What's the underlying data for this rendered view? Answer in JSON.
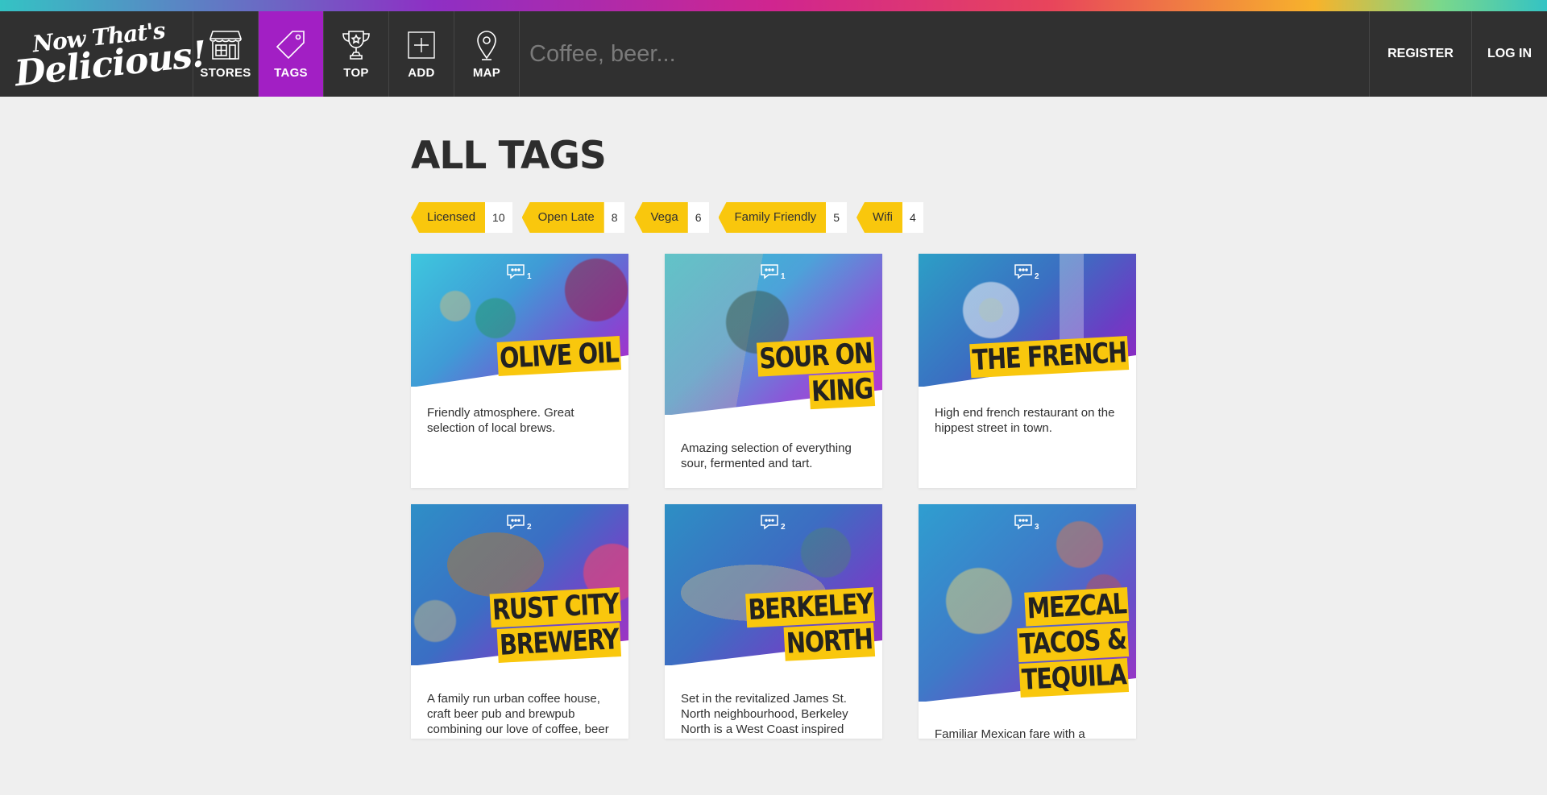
{
  "header": {
    "logo_line1": "Now That's",
    "logo_line2": "Delicious!",
    "nav": [
      {
        "label": "STORES",
        "icon": "store-icon"
      },
      {
        "label": "TAGS",
        "icon": "tag-icon"
      },
      {
        "label": "TOP",
        "icon": "trophy-icon"
      },
      {
        "label": "ADD",
        "icon": "add-icon"
      },
      {
        "label": "MAP",
        "icon": "map-pin-icon"
      }
    ],
    "search_placeholder": "Coffee, beer...",
    "register": "REGISTER",
    "login": "LOG IN"
  },
  "page_title": "ALL TAGS",
  "tags": [
    {
      "name": "Licensed",
      "count": "10"
    },
    {
      "name": "Open Late",
      "count": "8"
    },
    {
      "name": "Vega",
      "count": "6"
    },
    {
      "name": "Family Friendly",
      "count": "5"
    },
    {
      "name": "Wifi",
      "count": "4"
    }
  ],
  "stores": [
    {
      "title_lines": [
        "OLIVE OIL"
      ],
      "reviews": "1",
      "description": "Friendly atmosphere. Great selection of local brews."
    },
    {
      "title_lines": [
        "SOUR ON",
        "KING"
      ],
      "reviews": "1",
      "description": "Amazing selection of everything sour, fermented and tart."
    },
    {
      "title_lines": [
        "THE FRENCH"
      ],
      "reviews": "2",
      "description": "High end french restaurant on the hippest street in town."
    },
    {
      "title_lines": [
        "RUST CITY",
        "BREWERY"
      ],
      "reviews": "2",
      "description": "A family run urban coffee house, craft beer pub and brewpub combining our love of coffee, beer and people"
    },
    {
      "title_lines": [
        "BERKELEY",
        "NORTH"
      ],
      "reviews": "2",
      "description": "Set in the revitalized James St. North neighbourhood, Berkeley North is a West Coast inspired restaurant located on historic King William Street in the heart of downtown Hamilton."
    },
    {
      "title_lines": [
        "MEZCAL",
        "TACOS &",
        "TEQUILA"
      ],
      "reviews": "3",
      "description": "Familiar Mexican fare with a gourmet twist & housemade margaritas, plus a lively late-night scene."
    }
  ],
  "colors": {
    "active_nav": "#a21fc4",
    "tag_yellow": "#f9c70d",
    "nav_bg": "#303030",
    "page_bg": "#efefef"
  }
}
